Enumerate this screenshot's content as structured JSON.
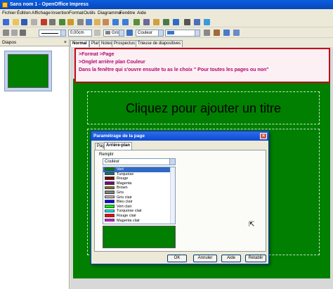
{
  "window": {
    "title": "Sans nom 1 - OpenOffice Impress"
  },
  "menu": [
    "Fichier",
    "Édition",
    "Affichage",
    "Insertion",
    "Format",
    "Outils",
    "Diagramma",
    "Fenêtre",
    "Aide"
  ],
  "toolbar": {
    "line_width": "0,00cm",
    "area_style": "Gris",
    "area_color": "Couleur"
  },
  "slides_pane": {
    "title": "Diapos"
  },
  "view_tabs": [
    "Normal",
    "Plan",
    "Notes",
    "Prospectus",
    "Trieuse de diapositives"
  ],
  "annotation": {
    "lines": [
      ">Format >Page",
      ">Onglet arrière plan Couleur",
      "Dans la fenêtre qui s'ouvre ensuite tu as le choix \" Pour toutes les pages ou non\""
    ]
  },
  "slide": {
    "title_placeholder": "Cliquez pour ajouter un titre"
  },
  "dialog": {
    "title": "Paramétrage de la page",
    "tabs": [
      "Page",
      "Arrière-plan"
    ],
    "group_label": "Remplir",
    "fill_type": "Couleur",
    "colors": [
      {
        "name": "Vert",
        "hex": "#007f00",
        "selected": true
      },
      {
        "name": "Turquoise",
        "hex": "#008080"
      },
      {
        "name": "Rouge",
        "hex": "#800000"
      },
      {
        "name": "Magenta",
        "hex": "#800080"
      },
      {
        "name": "Brown",
        "hex": "#808000"
      },
      {
        "name": "Gris",
        "hex": "#808080"
      },
      {
        "name": "Gris clair",
        "hex": "#c0c0c0"
      },
      {
        "name": "Bleu clair",
        "hex": "#0000ff"
      },
      {
        "name": "Vert clair",
        "hex": "#00ff00"
      },
      {
        "name": "Turquoise clair",
        "hex": "#00ffff"
      },
      {
        "name": "Rouge clair",
        "hex": "#ff0000"
      },
      {
        "name": "Magenta clair",
        "hex": "#ff00ff"
      }
    ],
    "buttons": {
      "ok": "OK",
      "cancel": "Annuler",
      "help": "Aide",
      "reset": "Rétablir"
    }
  }
}
